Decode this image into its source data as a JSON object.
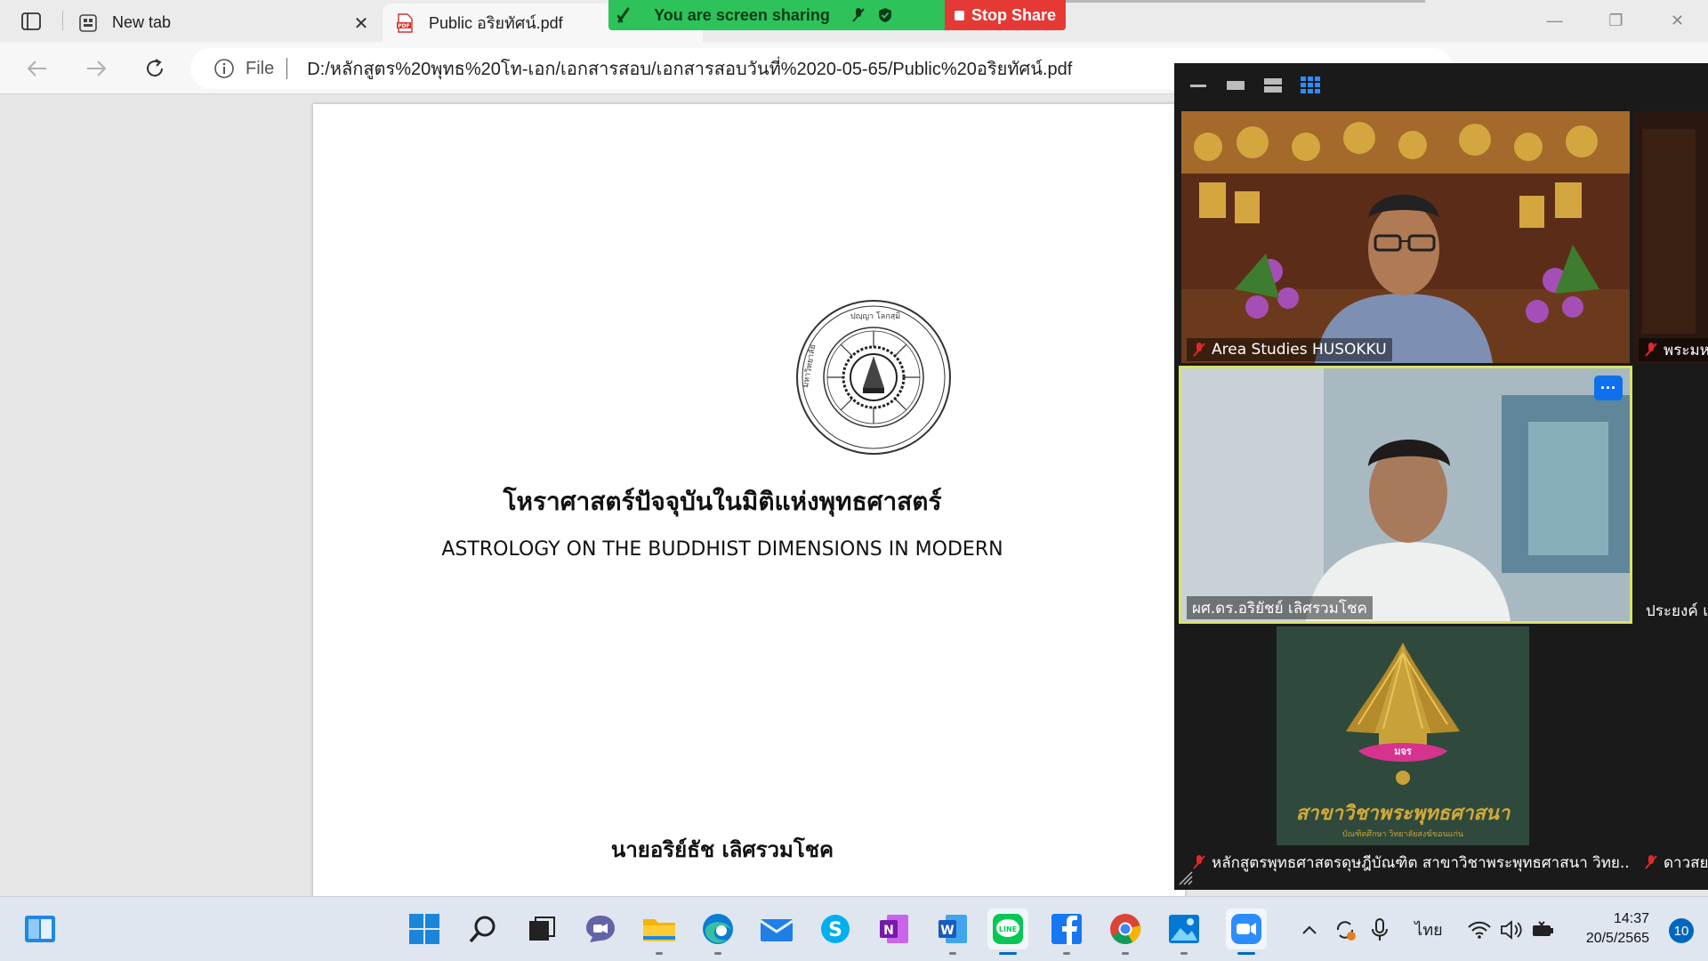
{
  "browser": {
    "tabs": [
      {
        "label": "New tab",
        "active": false
      },
      {
        "label": "Public อริยทัศน์.pdf",
        "active": true
      }
    ],
    "file_label": "File",
    "url": "D:/หลักสูตร%20พุทธ%20โท-เอก/เอกสารสอบ/เอกสารสอบวันที่%2020-05-65/Public%20อริยทัศน์.pdf"
  },
  "share_banner": {
    "text": "You are screen sharing",
    "stop_label": "Stop Share",
    "color": "#2ec35a",
    "stop_color": "#e53935"
  },
  "pdf": {
    "thai_title": "โหราศาสตร์ปัจจุบันในมิติแห่งพุทธศาสตร์",
    "english_title": "ASTROLOGY ON THE BUDDHIST DIMENSIONS IN MODERN",
    "author": "นายอริย์ธัช  เลิศรวมโชค"
  },
  "zoom": {
    "participants": [
      {
        "name": "Area Studies HUSOKKU",
        "muted": true
      },
      {
        "name": "พระมห",
        "muted": true
      },
      {
        "name": "ผศ.ดร.อริยัชย์ เลิศรวมโชค",
        "muted": false,
        "active_speaker": true
      },
      {
        "name": "ประยงค์ แส",
        "muted": false
      },
      {
        "name": "หลักสูตรพุทธศาสตรดุษฎีบัณฑิต สาขาวิชาพระพุทธศาสนา วิทย...",
        "muted": true
      },
      {
        "name": "ดาวสยา",
        "muted": true
      }
    ],
    "logo_text": "สาขาวิชาพระพุทธศาสนา",
    "logo_subtext": "บัณฑิตศึกษา วิทยาลัยสงฆ์ขอนแก่น",
    "logo_badge": "มจร",
    "accent": "#0e71eb",
    "speaker_border": "#d9e36a"
  },
  "taskbar": {
    "apps": [
      "windows-start",
      "search",
      "task-view",
      "teams-chat",
      "file-explorer",
      "edge",
      "mail",
      "skype",
      "onenote",
      "word",
      "line",
      "facebook",
      "chrome",
      "photos",
      "zoom"
    ],
    "language": "ไทย",
    "time": "14:37",
    "date": "20/5/2565",
    "notifications": "10"
  }
}
